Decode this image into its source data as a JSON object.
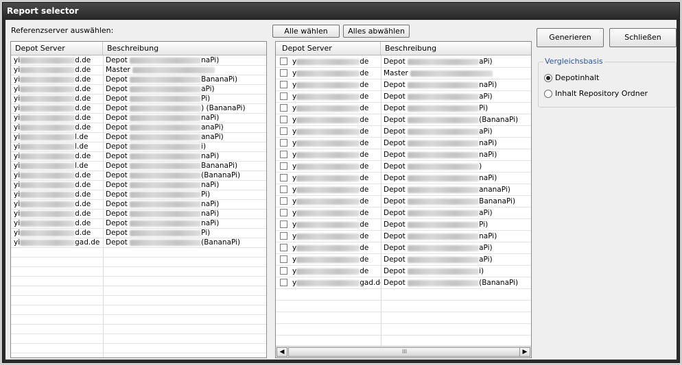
{
  "window": {
    "title": "Report selector"
  },
  "left_panel": {
    "label": "Referenzserver auswählen:",
    "columns": [
      "Depot Server",
      "Beschreibung"
    ],
    "rows": [
      {
        "server_pre": "yi",
        "server_post": "d.de",
        "desc_pre": "Depot",
        "desc_post": "naPi)"
      },
      {
        "server_pre": "yi",
        "server_post": "d.de",
        "desc_pre": "Master",
        "desc_post": ""
      },
      {
        "server_pre": "yi",
        "server_post": "d.de",
        "desc_pre": "Depot",
        "desc_post": "BananaPi)"
      },
      {
        "server_pre": "yi",
        "server_post": "d.de",
        "desc_pre": "Depot",
        "desc_post": "aPi)"
      },
      {
        "server_pre": "yi",
        "server_post": "d.de",
        "desc_pre": "Depot",
        "desc_post": "Pi)"
      },
      {
        "server_pre": "yi",
        "server_post": "d.de",
        "desc_pre": "Depot",
        "desc_post": ") (BananaPi)"
      },
      {
        "server_pre": "yi",
        "server_post": "d.de",
        "desc_pre": "Depot",
        "desc_post": "naPi)"
      },
      {
        "server_pre": "yi",
        "server_post": "d.de",
        "desc_pre": "Depot",
        "desc_post": "anaPi)"
      },
      {
        "server_pre": "yi",
        "server_post": "l.de",
        "desc_pre": "Depot",
        "desc_post": "anaPi)"
      },
      {
        "server_pre": "yi",
        "server_post": "l.de",
        "desc_pre": "Depot",
        "desc_post": "i)"
      },
      {
        "server_pre": "yi",
        "server_post": "d.de",
        "desc_pre": "Depot",
        "desc_post": "naPi)"
      },
      {
        "server_pre": "yi",
        "server_post": "l.de",
        "desc_pre": "Depot",
        "desc_post": "BananaPi)"
      },
      {
        "server_pre": "yi",
        "server_post": "d.de",
        "desc_pre": "Depot",
        "desc_post": "(BananaPi)"
      },
      {
        "server_pre": "yi",
        "server_post": "d.de",
        "desc_pre": "Depot",
        "desc_post": "naPi)"
      },
      {
        "server_pre": "yi",
        "server_post": "d.de",
        "desc_pre": "Depot",
        "desc_post": "Pi)"
      },
      {
        "server_pre": "yi",
        "server_post": "d.de",
        "desc_pre": "Depot",
        "desc_post": "naPi)"
      },
      {
        "server_pre": "yi",
        "server_post": "d.de",
        "desc_pre": "Depot",
        "desc_post": "naPi)"
      },
      {
        "server_pre": "yi",
        "server_post": "d.de",
        "desc_pre": "Depot",
        "desc_post": "naPi)"
      },
      {
        "server_pre": "yi",
        "server_post": "d.de",
        "desc_pre": "Depot",
        "desc_post": "Pi)"
      },
      {
        "server_pre": "yi",
        "server_post": "gad.de",
        "desc_pre": "Depot",
        "desc_post": "(BananaPi)"
      }
    ]
  },
  "middle_panel": {
    "select_all_label": "Alle wählen",
    "deselect_all_label": "Alles abwählen",
    "columns": [
      "Depot Server",
      "Beschreibung"
    ],
    "scroll_thumb_glyph": "III",
    "rows": [
      {
        "server_pre": "y",
        "server_post": "de",
        "desc_pre": "Depot",
        "desc_post": "aPi)"
      },
      {
        "server_pre": "y",
        "server_post": "de",
        "desc_pre": "Master",
        "desc_post": ""
      },
      {
        "server_pre": "y",
        "server_post": "de",
        "desc_pre": "Depot",
        "desc_post": "naPi)"
      },
      {
        "server_pre": "y",
        "server_post": "de",
        "desc_pre": "Depot",
        "desc_post": "aPi)"
      },
      {
        "server_pre": "y",
        "server_post": "de",
        "desc_pre": "Depot",
        "desc_post": "Pi)"
      },
      {
        "server_pre": "y",
        "server_post": "de",
        "desc_pre": "Depot",
        "desc_post": "(BananaPi)"
      },
      {
        "server_pre": "y",
        "server_post": "de",
        "desc_pre": "Depot",
        "desc_post": "aPi)"
      },
      {
        "server_pre": "y",
        "server_post": "de",
        "desc_pre": "Depot",
        "desc_post": "naPi)"
      },
      {
        "server_pre": "y",
        "server_post": "de",
        "desc_pre": "Depot",
        "desc_post": "naPi)"
      },
      {
        "server_pre": "y",
        "server_post": "de",
        "desc_pre": "Depot",
        "desc_post": ")"
      },
      {
        "server_pre": "y",
        "server_post": "de",
        "desc_pre": "Depot",
        "desc_post": "naPi)"
      },
      {
        "server_pre": "y",
        "server_post": "de",
        "desc_pre": "Depot",
        "desc_post": "ananaPi)"
      },
      {
        "server_pre": "y",
        "server_post": "de",
        "desc_pre": "Depot",
        "desc_post": "BananaPi)"
      },
      {
        "server_pre": "y",
        "server_post": "de",
        "desc_pre": "Depot",
        "desc_post": "aPi)"
      },
      {
        "server_pre": "y",
        "server_post": "de",
        "desc_pre": "Depot",
        "desc_post": "Pi)"
      },
      {
        "server_pre": "y",
        "server_post": "de",
        "desc_pre": "Depot",
        "desc_post": "naPi)"
      },
      {
        "server_pre": "y",
        "server_post": "de",
        "desc_pre": "Depot",
        "desc_post": "aPi)"
      },
      {
        "server_pre": "y",
        "server_post": "de",
        "desc_pre": "Depot",
        "desc_post": "aPi)"
      },
      {
        "server_pre": "y",
        "server_post": "de",
        "desc_pre": "Depot",
        "desc_post": "i)"
      },
      {
        "server_pre": "y",
        "server_post": "gad.de",
        "desc_pre": "Depot",
        "desc_post": "(BananaPi)"
      }
    ]
  },
  "right_panel": {
    "generate_label": "Generieren",
    "close_label": "Schließen",
    "group_title": "Vergleichsbasis",
    "options": [
      {
        "label": "Depotinhalt",
        "checked": true
      },
      {
        "label": "Inhalt Repository Ordner",
        "checked": false
      }
    ]
  }
}
